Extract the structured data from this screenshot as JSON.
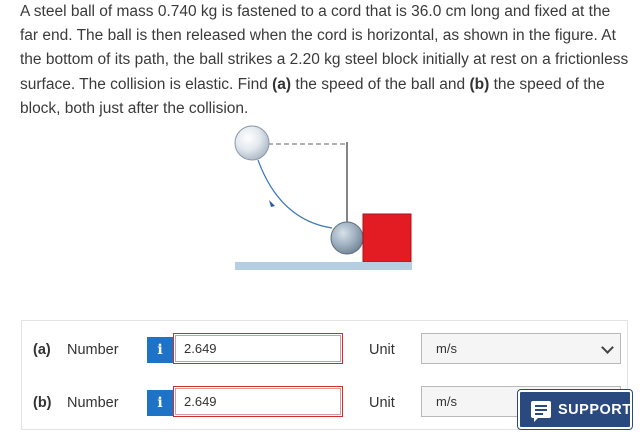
{
  "problem": {
    "t1": "A steel ball of mass 0.740 kg is fastened to a cord that is 36.0 cm long and fixed at the far end. The ball is then released when the cord is horizontal, as shown in the figure. At the bottom of its path, the ball strikes a 2.20 kg steel block initially at rest on a frictionless surface. The collision is elastic. Find ",
    "b1": "(a)",
    "t2": " the speed of the ball and ",
    "b2": "(b)",
    "t3": " the speed of the block, both just after the collision."
  },
  "answers": [
    {
      "part": "(a)",
      "kind": "Number",
      "info": "i",
      "value": "2.649",
      "unit_label": "Unit",
      "unit": "m/s"
    },
    {
      "part": "(b)",
      "kind": "Number",
      "info": "i",
      "value": "2.649",
      "unit_label": "Unit",
      "unit": "m/s"
    }
  ],
  "support": {
    "label": "SUPPORT"
  },
  "colors": {
    "block": "#e31b23",
    "info": "#1e73c7",
    "support": "#2a4a7f",
    "surface": "#b7cde0"
  }
}
